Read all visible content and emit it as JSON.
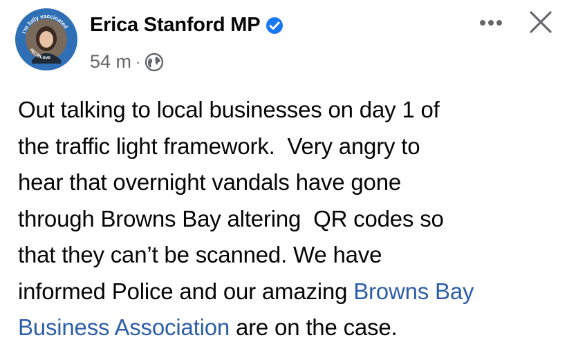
{
  "post": {
    "avatar": {
      "badge_top_text": "I'm fully vaccinated",
      "badge_bottom_text": "#ECBLove"
    },
    "author_name": "Erica Stanford MP",
    "timestamp": "54 m",
    "separator": "·",
    "privacy_icon": "globe-icon",
    "more_icon": "more-options-icon",
    "close_icon": "close-icon",
    "verified_icon": "verified-badge-icon",
    "text_lines": [
      "Out talking to local businesses on day 1 of",
      "the traffic light framework.  Very angry to",
      "hear that overnight vandals have gone",
      "through Browns Bay altering  QR codes so",
      "that they can’t be scanned. We have"
    ],
    "line6_prefix": "informed Police and our amazing ",
    "link_part1": "Browns Bay",
    "link_part2": "Business Association",
    "line7_suffix": " are on the case."
  },
  "colors": {
    "link": "#2d5ea8",
    "verified": "#1877f2",
    "meta": "#65676b",
    "avatar_ring": "#2f6fb5"
  }
}
